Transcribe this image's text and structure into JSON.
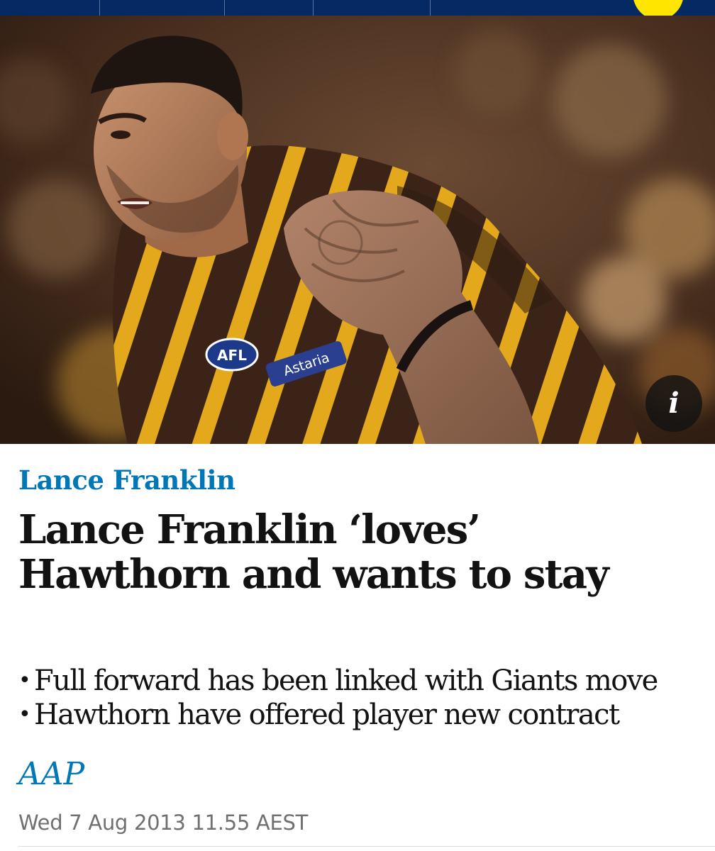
{
  "nav": {
    "items": [
      "",
      "",
      "",
      "",
      "",
      ""
    ]
  },
  "colors": {
    "nav_background": "#052962",
    "accent": "#0077b6",
    "profile_badge": "#ffe500",
    "headline": "#121212",
    "meta": "#707070"
  },
  "hero": {
    "icons": [
      "info-icon"
    ],
    "info_label": "i"
  },
  "article": {
    "kicker": "Lance Franklin",
    "headline": "Lance Franklin ‘loves’ Hawthorn and wants to stay",
    "standfirst": [
      "Full forward has been linked with Giants move",
      "Hawthorn have offered player new contract"
    ],
    "bullet": "•",
    "byline": "AAP",
    "date": "Wed 7 Aug 2013 11.55 AEST"
  },
  "image_text": {
    "logo": "AFL",
    "sponsor": "Astaria"
  }
}
